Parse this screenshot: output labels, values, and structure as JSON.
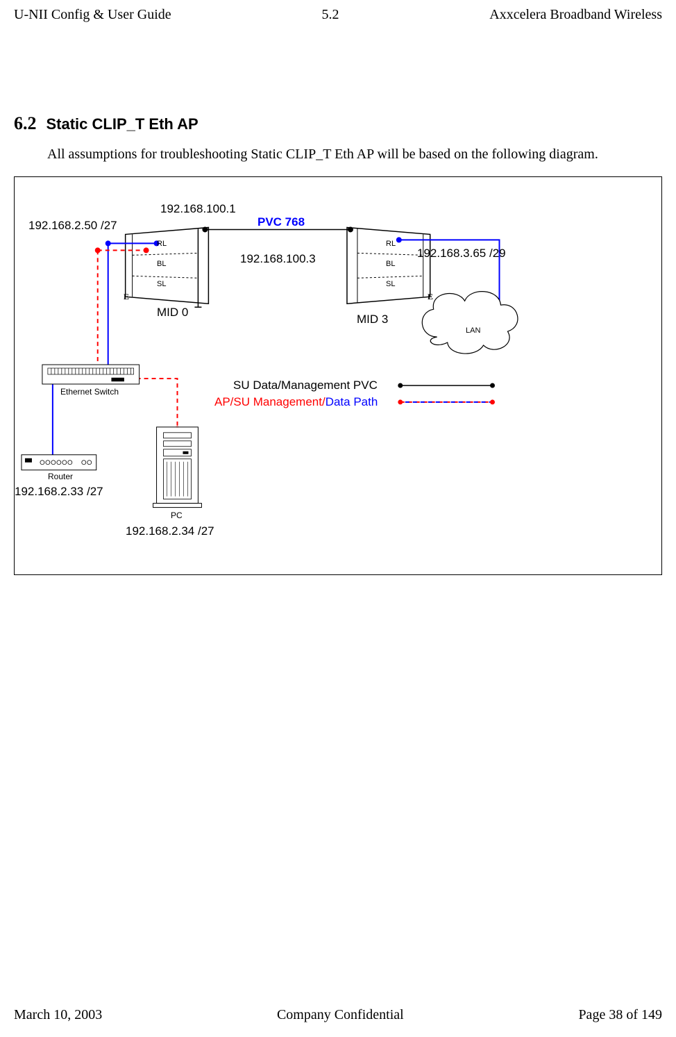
{
  "header": {
    "left": "U-NII Config & User Guide",
    "center": "5.2",
    "right": "Axxcelera Broadband Wireless"
  },
  "section": {
    "num": "6.2",
    "title": "Static CLIP_T Eth AP",
    "para": "All assumptions for troubleshooting Static CLIP_T Eth AP will be based on the following diagram."
  },
  "diagram": {
    "ip_top": "192.168.100.1",
    "ip_left": "192.168.2.50  /27",
    "pvc": "PVC 768",
    "ip_mid": "192.168.100.3",
    "ip_right": "192.168.3.65 /29",
    "mid_left": "MID 0",
    "mid_right": "MID 3",
    "rl": "RL",
    "bl": "BL",
    "sl": "SL",
    "e": "E",
    "lan": "LAN",
    "switch_label": "Ethernet Switch",
    "router_label": "Router",
    "pc_label": "PC",
    "ip_router": "192.168.2.33  /27",
    "ip_pc": "192.168.2.34  /27",
    "legend1": "SU Data/Management PVC",
    "legend2a": "AP/SU  Management/",
    "legend2b": "Data Path"
  },
  "footer": {
    "left": "March 10, 2003",
    "center": "Company Confidential",
    "right": "Page 38 of 149"
  }
}
